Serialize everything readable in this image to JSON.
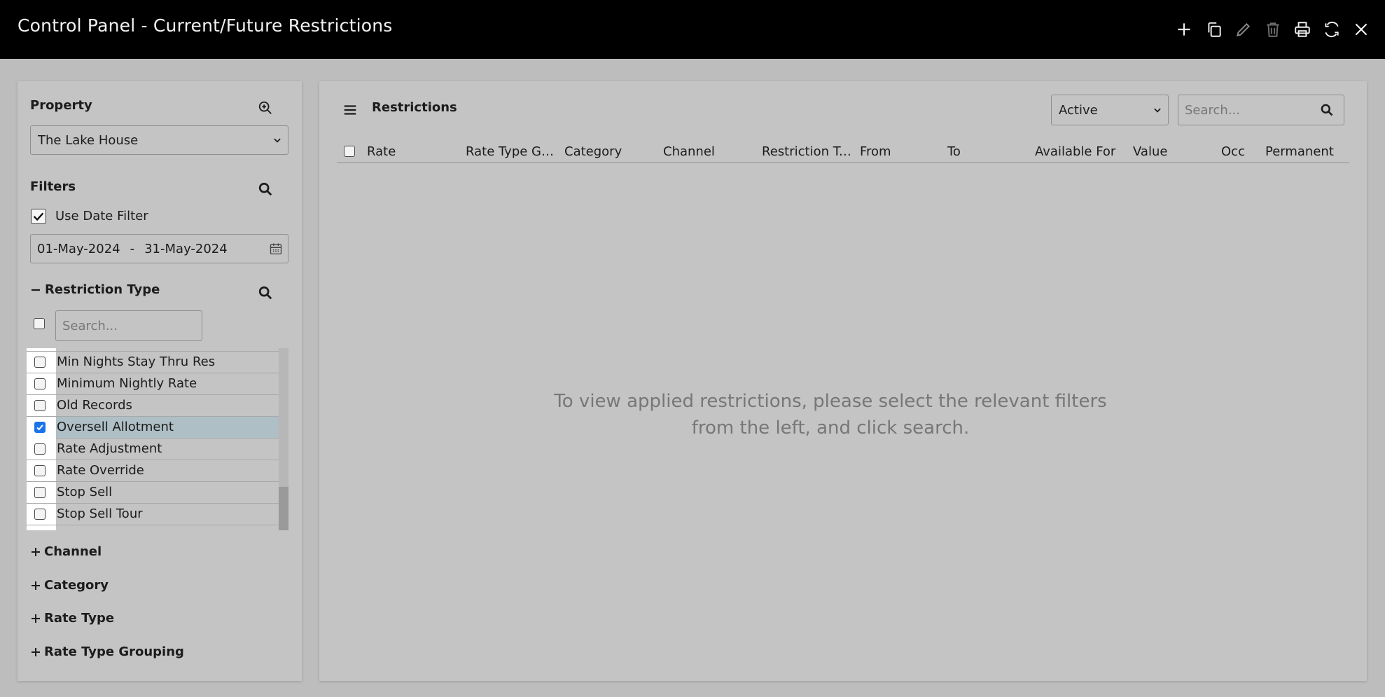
{
  "window": {
    "title": "Control Panel - Current/Future Restrictions",
    "toolbar_icons": [
      "plus-icon",
      "copy-icon",
      "pencil-icon",
      "trash-icon",
      "printer-icon",
      "refresh-icon",
      "close-icon"
    ]
  },
  "left_panel": {
    "property": {
      "label": "Property",
      "selected": "The Lake House"
    },
    "filters": {
      "label": "Filters",
      "use_date_filter_label": "Use Date Filter",
      "use_date_filter_checked": true,
      "date_from": "01-May-2024",
      "date_separator": "-",
      "date_to": "31-May-2024"
    },
    "restriction_type": {
      "label": "Restriction Type",
      "search_placeholder": "Search...",
      "items": [
        {
          "label": "Min Nights Stay Thru Res",
          "checked": false
        },
        {
          "label": "Minimum Nightly Rate",
          "checked": false
        },
        {
          "label": "Old Records",
          "checked": false
        },
        {
          "label": "Oversell Allotment",
          "checked": true
        },
        {
          "label": "Rate Adjustment",
          "checked": false
        },
        {
          "label": "Rate Override",
          "checked": false
        },
        {
          "label": "Stop Sell",
          "checked": false
        },
        {
          "label": "Stop Sell Tour",
          "checked": false
        }
      ]
    },
    "collapsed_sections": [
      {
        "label": "Channel"
      },
      {
        "label": "Category"
      },
      {
        "label": "Rate Type"
      },
      {
        "label": "Rate Type Grouping"
      }
    ]
  },
  "right_panel": {
    "title": "Restrictions",
    "status_select": "Active",
    "search_placeholder": "Search...",
    "columns": [
      "Rate",
      "Rate Type Gro...",
      "Category",
      "Channel",
      "Restriction Ty...",
      "From",
      "To",
      "Available For",
      "Value",
      "Occ",
      "Permanent"
    ],
    "empty_message": "To view applied restrictions, please select the relevant filters from the left, and click search."
  },
  "colors": {
    "titlebar": "#000000",
    "background": "#bdbdbd",
    "panel": "#c4c4c4",
    "selected_row": "#aebfc6",
    "checkbox_checked": "#1a73e8"
  }
}
